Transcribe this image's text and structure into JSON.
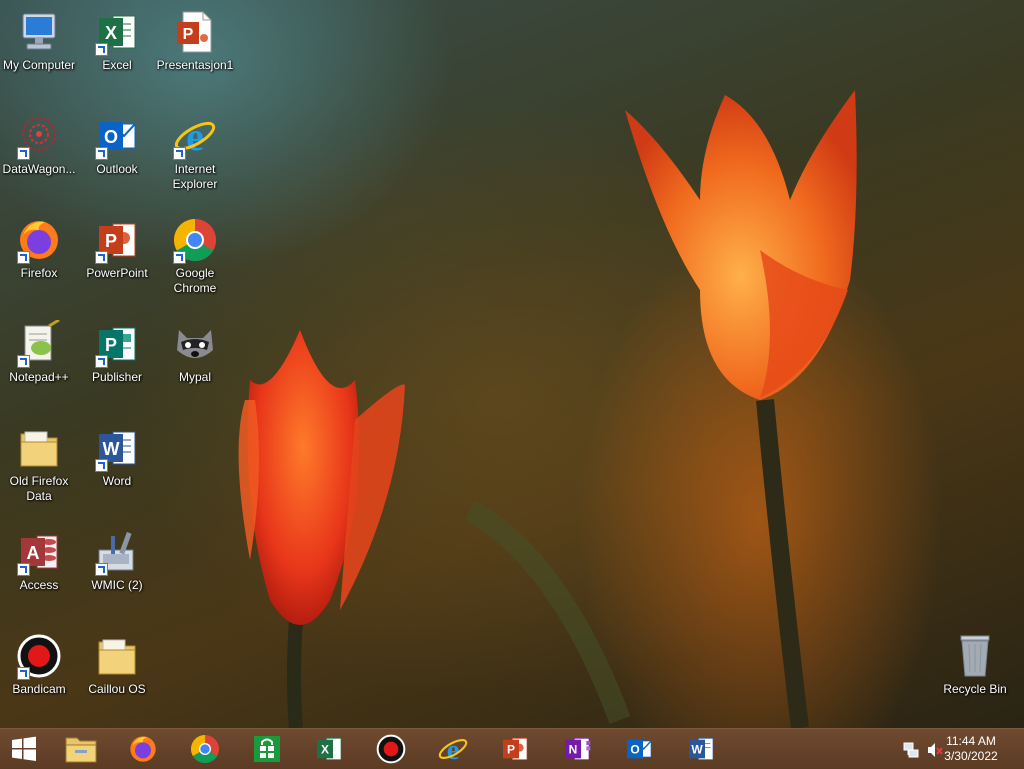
{
  "desktop": {
    "icons": {
      "my_computer": "My Computer",
      "excel": "Excel",
      "presentasjon": "Presentasjon1",
      "datawagon": "DataWagon...",
      "outlook": "Outlook",
      "internet_explorer": "Internet Explorer",
      "firefox": "Firefox",
      "powerpoint": "PowerPoint",
      "google_chrome": "Google Chrome",
      "notepad": "Notepad++",
      "publisher": "Publisher",
      "mypal": "Mypal",
      "old_firefox_data": "Old Firefox Data",
      "word": "Word",
      "access": "Access",
      "wmic": "WMIC (2)",
      "bandicam": "Bandicam",
      "caillou_os": "Caillou OS",
      "recycle_bin": "Recycle Bin"
    }
  },
  "taskbar": {
    "pinned": [
      "start",
      "file-explorer",
      "firefox",
      "chrome",
      "store",
      "excel",
      "bandicam",
      "internet-explorer",
      "powerpoint",
      "onenote",
      "outlook",
      "word"
    ],
    "tray": {
      "time": "11:44 AM",
      "date": "3/30/2022"
    }
  },
  "colors": {
    "taskbar": "#5c3b24",
    "excel": "#1e7145",
    "outlook": "#0a64c8",
    "powerpoint": "#c43e1c",
    "publisher": "#077568",
    "word": "#2b579a",
    "access": "#a4373a",
    "onenote": "#7719aa"
  }
}
